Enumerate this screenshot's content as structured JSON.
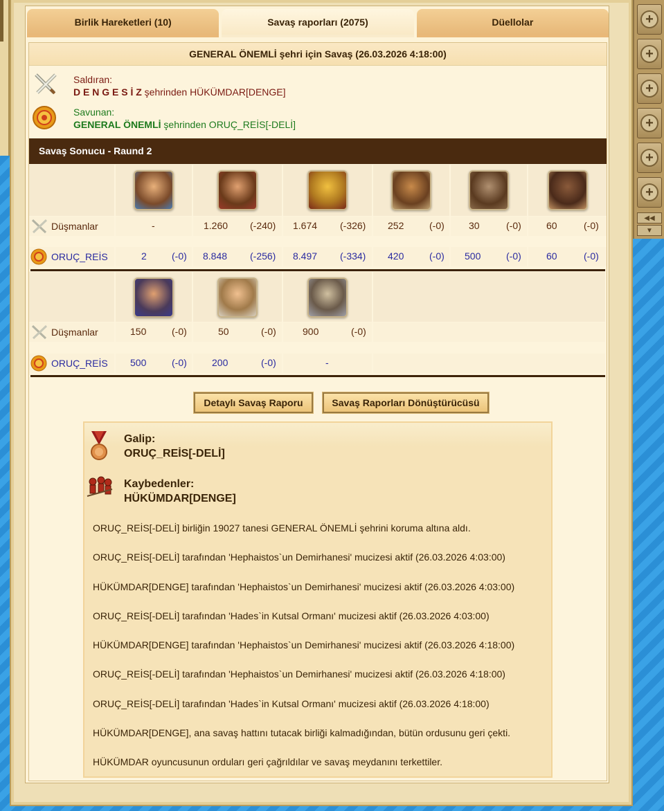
{
  "tabs": [
    {
      "label": "Birlik Hareketleri (10)",
      "active": false
    },
    {
      "label": "Savaş raporları (2075)",
      "active": true
    },
    {
      "label": "Düellolar",
      "active": false
    }
  ],
  "report": {
    "title": "GENERAL ÖNEMLİ şehri için Savaş (26.03.2026 4:18:00)",
    "attacker_label": "Saldıran:",
    "attacker_city": "D E N G E S İ Z",
    "attacker_rest": " şehrinden HÜKÜMDAR[DENGE]",
    "defender_label": "Savunan:",
    "defender_city": "GENERAL ÖNEMLİ",
    "defender_rest": " şehrinden ORUÇ_REİS[-DELİ]",
    "result_header": "Savaş Sonucu - Raund 2"
  },
  "battle": {
    "enemy_label": "Düşmanlar",
    "defender_label": "ORUÇ_REİS",
    "row1_enemy": [
      [
        "-",
        ""
      ],
      [
        "1.260",
        "(-240)"
      ],
      [
        "1.674",
        "(-326)"
      ],
      [
        "252",
        "(-0)"
      ],
      [
        "30",
        "(-0)"
      ],
      [
        "60",
        "(-0)"
      ]
    ],
    "row1_def": [
      [
        "2",
        "(-0)"
      ],
      [
        "8.848",
        "(-256)"
      ],
      [
        "8.497",
        "(-334)"
      ],
      [
        "420",
        "(-0)"
      ],
      [
        "500",
        "(-0)"
      ],
      [
        "60",
        "(-0)"
      ]
    ],
    "row2_enemy": [
      [
        "150",
        "(-0)"
      ],
      [
        "50",
        "(-0)"
      ],
      [
        "900",
        "(-0)"
      ]
    ],
    "row2_def": [
      [
        "500",
        "(-0)"
      ],
      [
        "200",
        "(-0)"
      ],
      [
        "-",
        ""
      ]
    ]
  },
  "buttons": {
    "detailed": "Detaylı Savaş Raporu",
    "converter": "Savaş Raporları Dönüştürücüsü"
  },
  "summary": {
    "winner_label": "Galip:",
    "winner_name": "ORUÇ_REİS[-DELİ]",
    "loser_label": "Kaybedenler:",
    "loser_name": "HÜKÜMDAR[DENGE]",
    "messages": [
      "ORUÇ_REİS[-DELİ] birliğin 19027 tanesi GENERAL ÖNEMLİ şehrini koruma altına aldı.",
      "ORUÇ_REİS[-DELİ] tarafından 'Hephaistos`un Demirhanesi' mucizesi aktif (26.03.2026 4:03:00)",
      "HÜKÜMDAR[DENGE] tarafından 'Hephaistos`un Demirhanesi' mucizesi aktif (26.03.2026 4:03:00)",
      "ORUÇ_REİS[-DELİ] tarafından 'Hades`in Kutsal Ormanı' mucizesi aktif (26.03.2026 4:03:00)",
      "HÜKÜMDAR[DENGE] tarafından 'Hephaistos`un Demirhanesi' mucizesi aktif (26.03.2026 4:18:00)",
      "ORUÇ_REİS[-DELİ] tarafından 'Hephaistos`un Demirhanesi' mucizesi aktif (26.03.2026 4:18:00)",
      "ORUÇ_REİS[-DELİ] tarafından 'Hades`in Kutsal Ormanı' mucizesi aktif (26.03.2026 4:18:00)",
      "HÜKÜMDAR[DENGE], ana savaş hattını tutacak birliği kalmadığından, bütün ordusunu geri çekti.",
      "HÜKÜMDAR oyuncusunun orduları geri çağrıldılar ve savaş meydanını terkettiler."
    ]
  },
  "sidebar": {
    "buttons": [
      "+",
      "+",
      "+",
      "+",
      "+",
      "+"
    ]
  },
  "colors": {
    "header_bg": "#4a2a0f",
    "enemy_text": "#5a2a0e",
    "defender_text": "#2a2aa0",
    "defender_city": "#1d7a1d",
    "attacker_city": "#7a1a12"
  }
}
